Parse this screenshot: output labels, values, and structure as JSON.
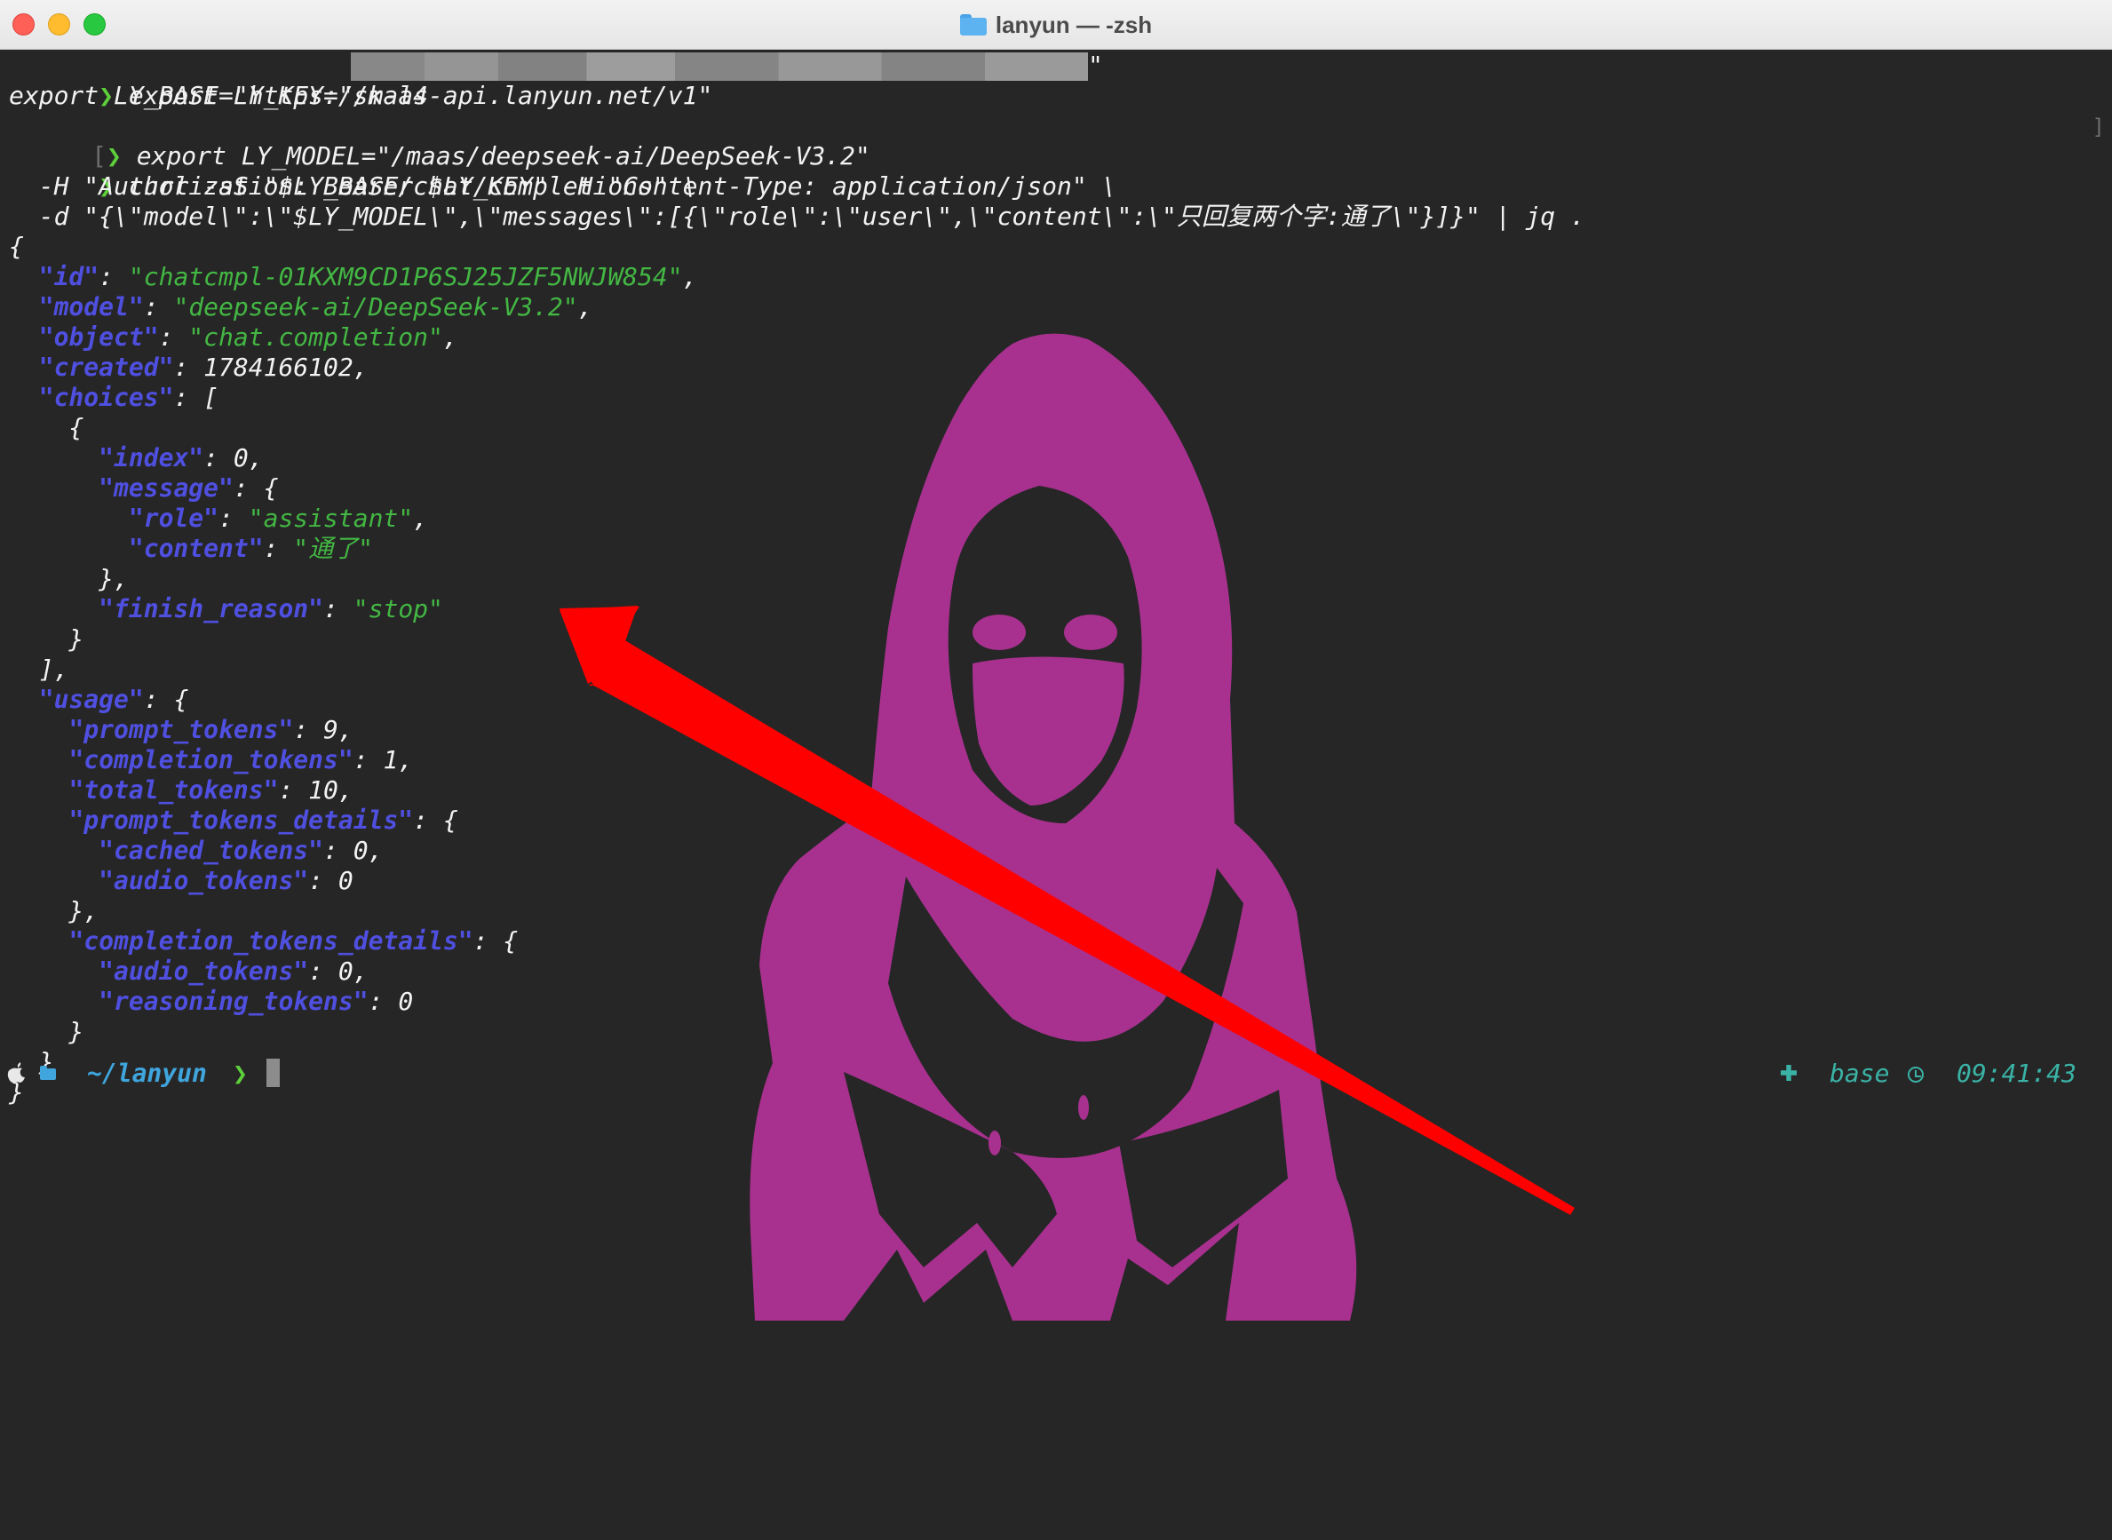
{
  "window": {
    "title": "lanyun — -zsh"
  },
  "commands": {
    "line1_prefix": "export LY_KEY=\"sk-l4",
    "line1_suffix": "\"",
    "line2": "export LY_BASE=\"https://maas-api.lanyun.net/v1\"",
    "line3": "export LY_MODEL=\"/maas/deepseek-ai/DeepSeek-V3.2\"",
    "line4": "curl -sS \"$LY_BASE/chat/completions\" \\",
    "line5": "  -H \"Authorization: Bearer $LY_KEY\" -H \"Content-Type: application/json\" \\",
    "line6": "  -d \"{\\\"model\\\":\\\"$LY_MODEL\\\",\\\"messages\\\":[{\\\"role\\\":\\\"user\\\",\\\"content\\\":\\\"只回复两个字:通了\\\"}]}\" | jq ."
  },
  "response": {
    "id": "chatcmpl-01KXM9CD1P6SJ25JZF5NWJW854",
    "model": "deepseek-ai/DeepSeek-V3.2",
    "object": "chat.completion",
    "created": "1784166102",
    "index": "0",
    "role": "assistant",
    "content": "通了",
    "finish_reason": "stop",
    "prompt_tokens": "9",
    "completion_tokens": "1",
    "total_tokens": "10",
    "cached_tokens": "0",
    "prompt_audio_tokens": "0",
    "completion_audio_tokens": "0",
    "reasoning_tokens": "0"
  },
  "prompt": {
    "cwd": "~/lanyun",
    "env": "base",
    "time": "09:41:43"
  },
  "colors": {
    "background": "#262626",
    "key": "#4f4fe0",
    "string": "#43b743",
    "prompt_arrow": "#5ed03b",
    "cwd": "#3fa5dc",
    "status": "#3ab3a6",
    "figure": "#a8318f",
    "arrow": "#ff0000"
  }
}
